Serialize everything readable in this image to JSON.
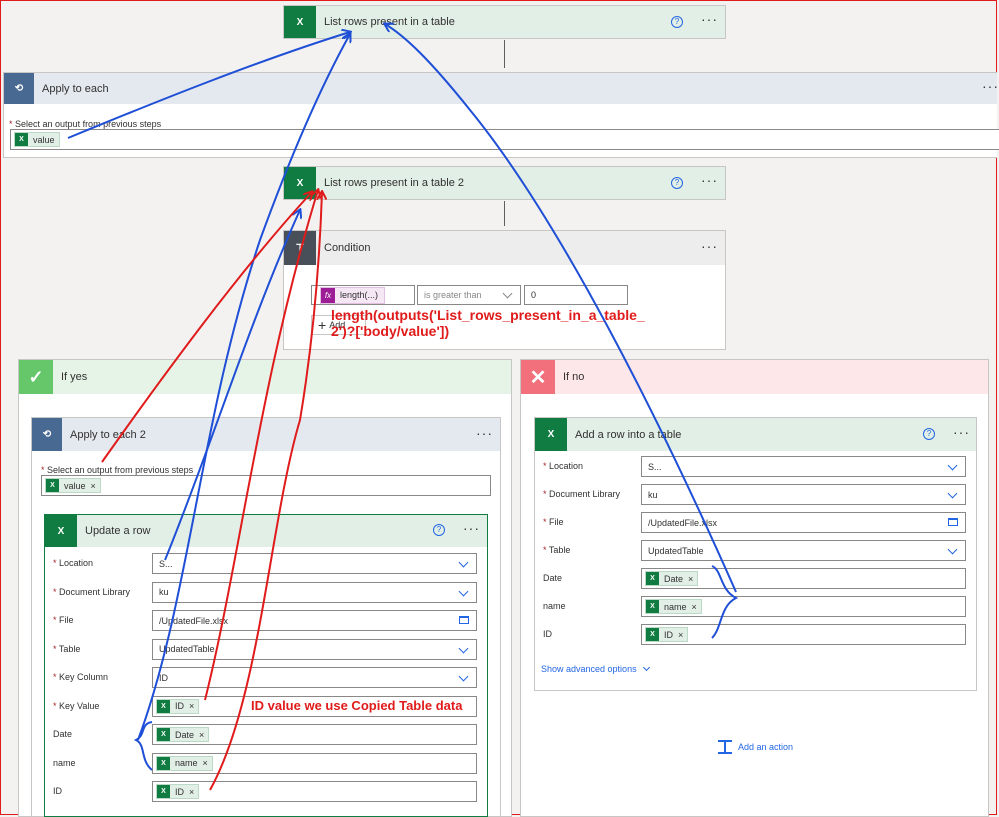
{
  "steps": {
    "list_rows": {
      "title": "List rows present in a table"
    },
    "apply_each": {
      "title": "Apply to each",
      "select_label": "Select an output from previous steps",
      "token": "value"
    },
    "list_rows2": {
      "title": "List rows present in a table 2"
    },
    "condition": {
      "title": "Condition",
      "expr_token": "length(...)",
      "operator": "is greater than",
      "value": "0",
      "add_label": "Add"
    },
    "if_yes": {
      "title": "If yes"
    },
    "if_no": {
      "title": "If no"
    },
    "apply_each2": {
      "title": "Apply to each 2",
      "select_label": "Select an output from previous steps",
      "token": "value"
    },
    "update_row": {
      "title": "Update a row",
      "fields": [
        {
          "label": "Location",
          "required": true,
          "value": "S...",
          "type": "dropdown"
        },
        {
          "label": "Document Library",
          "required": true,
          "value": "ku",
          "type": "dropdown"
        },
        {
          "label": "File",
          "required": true,
          "value": "/UpdatedFile.xlsx",
          "type": "file"
        },
        {
          "label": "Table",
          "required": true,
          "value": "UpdatedTable",
          "type": "dropdown"
        },
        {
          "label": "Key Column",
          "required": true,
          "value": "ID",
          "type": "dropdown"
        },
        {
          "label": "Key Value",
          "required": true,
          "token": "ID",
          "type": "token"
        },
        {
          "label": "Date",
          "required": false,
          "token": "Date",
          "type": "token"
        },
        {
          "label": "name",
          "required": false,
          "token": "name",
          "type": "token"
        },
        {
          "label": "ID",
          "required": false,
          "token": "ID",
          "type": "token"
        }
      ]
    },
    "add_row": {
      "title": "Add a row into a table",
      "fields": [
        {
          "label": "Location",
          "required": true,
          "value": "S...",
          "type": "dropdown"
        },
        {
          "label": "Document Library",
          "required": true,
          "value": "ku",
          "type": "dropdown"
        },
        {
          "label": "File",
          "required": true,
          "value": "/UpdatedFile.xlsx",
          "type": "file"
        },
        {
          "label": "Table",
          "required": true,
          "value": "UpdatedTable",
          "type": "dropdown"
        },
        {
          "label": "Date",
          "required": false,
          "token": "Date",
          "type": "token"
        },
        {
          "label": "name",
          "required": false,
          "token": "name",
          "type": "token"
        },
        {
          "label": "ID",
          "required": false,
          "token": "ID",
          "type": "token"
        }
      ],
      "advanced_label": "Show advanced options",
      "add_action_label": "Add an action"
    }
  },
  "annotations": {
    "expression_line1": "length(outputs('List_rows_present_in_a_table_",
    "expression_line2": "2')?['body/value'])",
    "key_value_note": "ID value we use Copied Table data"
  },
  "icons": {
    "excel": "excel-icon",
    "loop": "loop-icon",
    "condition": "condition-icon",
    "check": "check-icon",
    "close": "close-icon",
    "help": "help-icon",
    "more": "more-icon",
    "expression": "fx-icon"
  },
  "colors": {
    "excel_green": "#107c41",
    "loop_blue": "#486991",
    "annotation_red": "#e01b1b",
    "annotation_blue": "#1f4fd6",
    "yes_green": "#66c76a",
    "no_red": "#f1707b"
  }
}
